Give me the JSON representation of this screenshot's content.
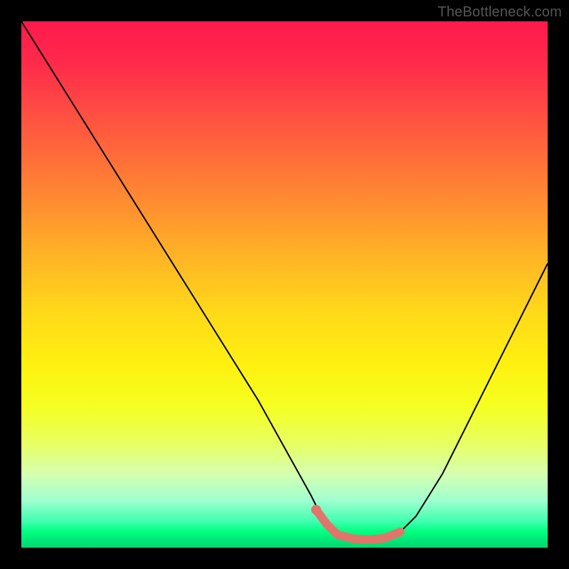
{
  "watermark": "TheBottleneck.com",
  "chart_data": {
    "type": "line",
    "title": "",
    "xlabel": "",
    "ylabel": "",
    "xlim": [
      0,
      100
    ],
    "ylim": [
      0,
      100
    ],
    "grid": false,
    "series": [
      {
        "name": "bottleneck-curve",
        "x": [
          0,
          5,
          10,
          15,
          20,
          25,
          30,
          35,
          40,
          45,
          50,
          55,
          57,
          60,
          63,
          66,
          69,
          72,
          75,
          80,
          85,
          90,
          95,
          100
        ],
        "values": [
          100,
          92,
          84,
          76,
          68,
          60,
          52,
          44,
          36,
          28,
          19,
          10,
          6,
          2.5,
          1.7,
          1.5,
          1.8,
          3,
          6,
          14,
          24,
          34,
          44,
          54
        ]
      }
    ],
    "highlight": {
      "name": "optimal-range",
      "x": [
        56,
        58,
        60,
        63,
        66,
        69,
        72
      ],
      "values": [
        7.2,
        4.5,
        2.5,
        1.7,
        1.5,
        1.8,
        3.0
      ]
    },
    "background_gradient": {
      "top": "#ff1a4d",
      "mid": "#fff010",
      "bottom": "#00e878"
    }
  }
}
